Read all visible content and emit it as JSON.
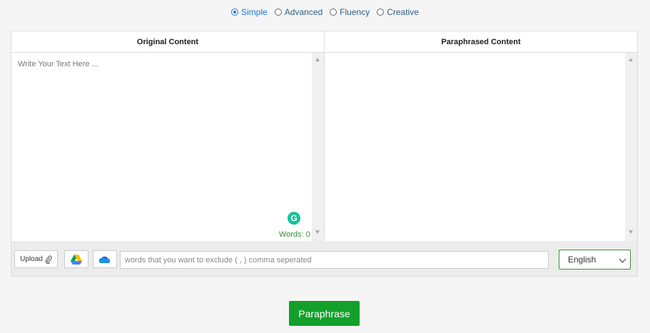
{
  "modes": [
    {
      "label": "Simple",
      "checked": true
    },
    {
      "label": "Advanced",
      "checked": false
    },
    {
      "label": "Fluency",
      "checked": false
    },
    {
      "label": "Creative",
      "checked": false
    }
  ],
  "original": {
    "header": "Original Content",
    "placeholder": "Write Your Text Here ...",
    "words_label": "Words: 0"
  },
  "paraphrased": {
    "header": "Paraphrased Content"
  },
  "toolbar": {
    "upload_label": "Upload",
    "exclude_placeholder": "words that you want to exclude ( , ) comma seperated",
    "language": "English"
  },
  "grammarly_letter": "G",
  "paraphrase_button": "Paraphrase",
  "colors": {
    "accent_green": "#12a02b",
    "radio_blue": "#1a73e8",
    "grammarly": "#15c39a"
  }
}
